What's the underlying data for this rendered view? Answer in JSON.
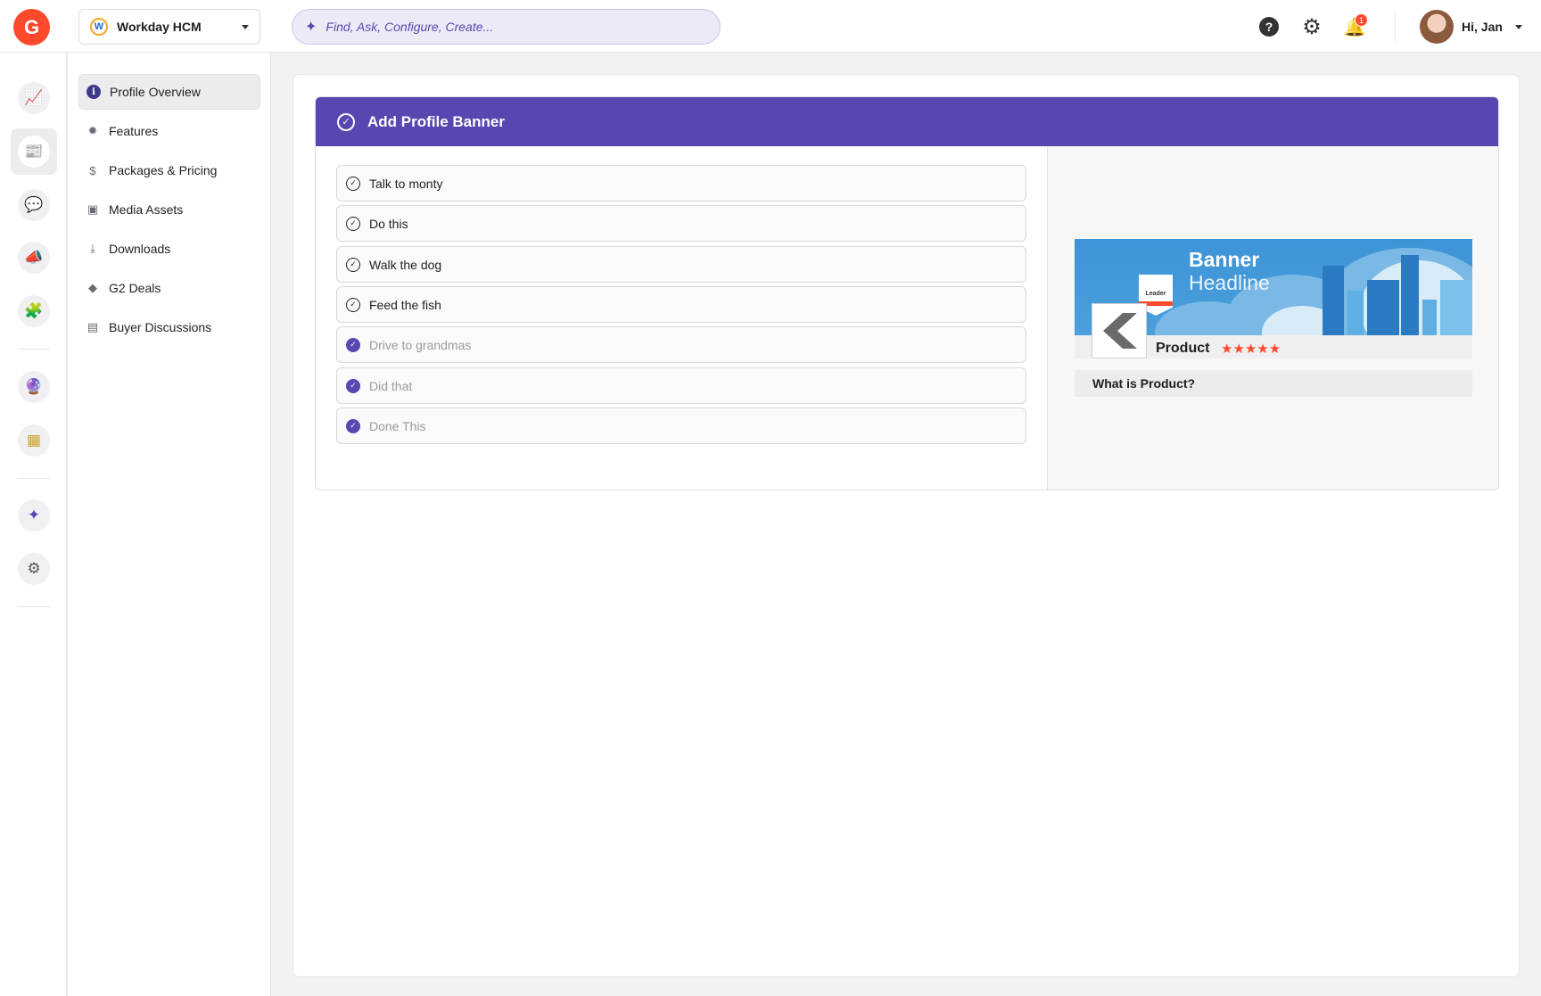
{
  "header": {
    "logo_text": "G",
    "product_selector": {
      "logo_letter": "W",
      "value": "Workday HCM"
    },
    "search": {
      "placeholder": "Find, Ask, Configure, Create..."
    },
    "help_label": "?",
    "notifications_count": "1",
    "user_greeting": "Hi, Jan"
  },
  "rail": {
    "items": [
      {
        "name": "analytics-icon",
        "glyph": "📈"
      },
      {
        "name": "profile-icon",
        "glyph": "📰"
      },
      {
        "name": "reviews-icon",
        "glyph": "💬"
      },
      {
        "name": "marketing-icon",
        "glyph": "📣"
      },
      {
        "name": "integrations-icon",
        "glyph": "🧩"
      },
      {
        "name": "insights-icon",
        "glyph": "🔮"
      },
      {
        "name": "grid-icon",
        "glyph": "▦"
      },
      {
        "name": "ai-sparkle-icon",
        "glyph": "✦"
      },
      {
        "name": "settings-sliders-icon",
        "glyph": "⚙"
      }
    ]
  },
  "subnav": {
    "items": [
      {
        "label": "Profile Overview",
        "icon": "i"
      },
      {
        "label": "Features",
        "icon": "✹"
      },
      {
        "label": "Packages & Pricing",
        "icon": "$"
      },
      {
        "label": "Media Assets",
        "icon": "▣"
      },
      {
        "label": "Downloads",
        "icon": "⤓"
      },
      {
        "label": "G2 Deals",
        "icon": "◆"
      },
      {
        "label": "Buyer Discussions",
        "icon": "▤"
      }
    ]
  },
  "panel": {
    "title": "Add Profile Banner",
    "tasks": [
      {
        "label": "Talk to monty",
        "done": false
      },
      {
        "label": "Do this",
        "done": false
      },
      {
        "label": "Walk the dog",
        "done": false
      },
      {
        "label": "Feed the fish",
        "done": false
      },
      {
        "label": "Drive to grandmas",
        "done": true
      },
      {
        "label": "Did that",
        "done": true
      },
      {
        "label": "Done This",
        "done": true
      }
    ],
    "preview": {
      "banner_title": "Banner",
      "banner_subtitle": "Headline",
      "badge_text": "Leader",
      "product_name": "Product",
      "rating_stars": "★★★★★",
      "what_is": "What is Product?"
    }
  },
  "colors": {
    "brand_red": "#ff492c",
    "accent_purple": "#5847b0",
    "banner_blue": "#3e94d6"
  }
}
